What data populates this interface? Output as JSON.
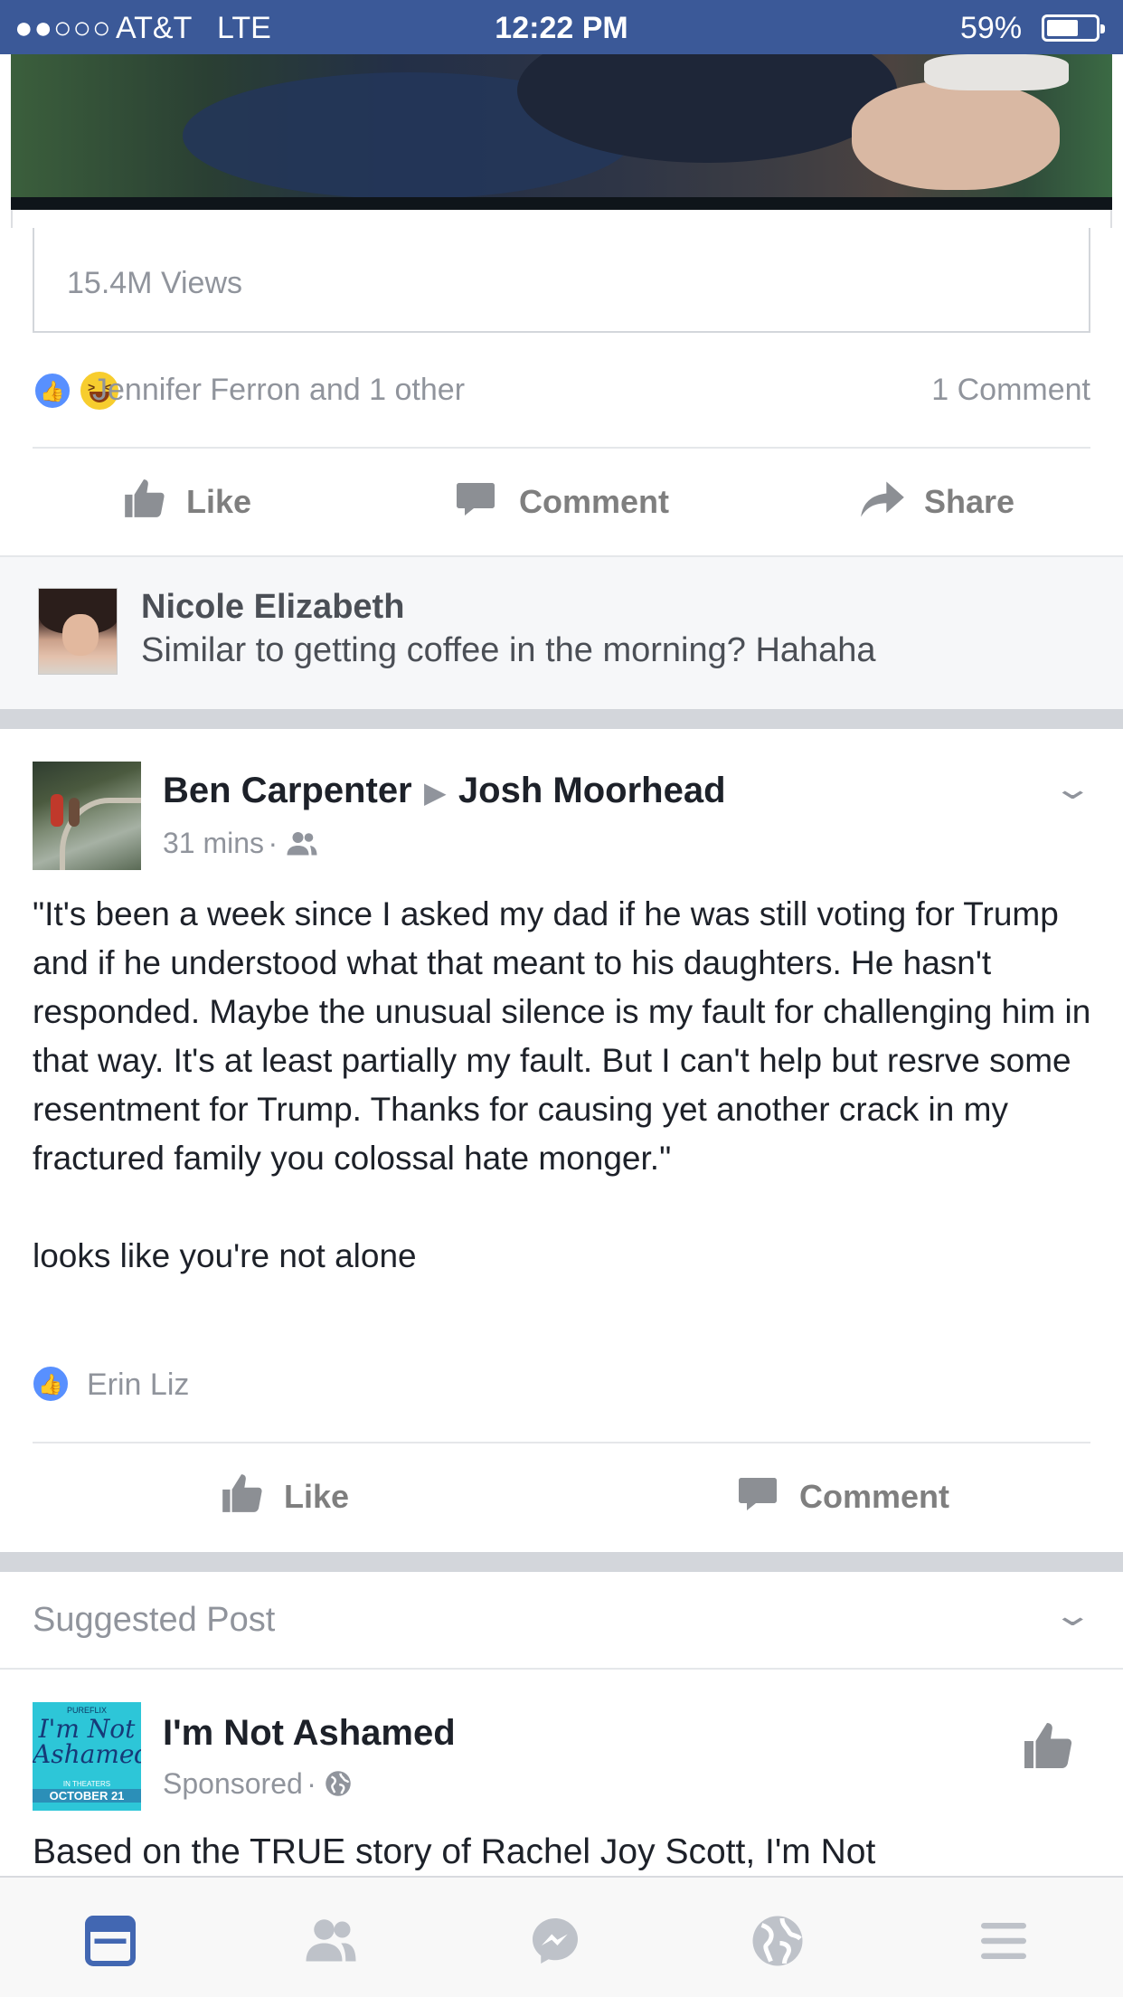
{
  "status_bar": {
    "signal": "●●○○○",
    "carrier": "AT&T",
    "network": "LTE",
    "time": "12:22 PM",
    "battery": "59%",
    "battery_level": 0.59
  },
  "video_post": {
    "views": "15.4M Views",
    "reactions_text": "Jennifer Ferron and 1 other",
    "comment_count": "1 Comment",
    "actions": {
      "like": "Like",
      "comment": "Comment",
      "share": "Share"
    }
  },
  "comment": {
    "author": "Nicole Elizabeth",
    "text": "Similar to getting coffee in the morning? Hahaha"
  },
  "post": {
    "author": "Ben Carpenter",
    "recipient": "Josh Moorhead",
    "time": "31 mins",
    "quote": "\"It's been a week since I asked my dad if he was still voting for Trump and if he understood what that meant to his daughters. He hasn't responded. Maybe the unusual silence is my fault for challenging him in that way. It's at least partially my fault. But I can't help but resrve some resentment for Trump. Thanks for causing yet another crack in my fractured family you colossal hate monger.\"",
    "comment": "looks like you're not alone",
    "liked_by": "Erin Liz",
    "actions": {
      "like": "Like",
      "comment": "Comment"
    }
  },
  "suggested": {
    "title": "Suggested Post",
    "page_name": "I'm Not Ashamed",
    "sponsored": "Sponsored",
    "logo": {
      "top": "PUREFLIX",
      "title": "I'm Not Ashamed",
      "sub": "IN THEATERS",
      "date": "OCTOBER 21"
    },
    "text": "Based on the TRUE story of Rachel Joy Scott, I'm Not"
  },
  "bottom_nav": {
    "items": [
      "news-feed-icon",
      "friends-icon",
      "messenger-icon",
      "globe-icon",
      "menu-icon"
    ],
    "active_color": "#4267b2",
    "inactive_color": "#bec2c9"
  },
  "colors": {
    "brand": "#3b5998",
    "like_blue": "#5890ff",
    "meta_gray": "#90949c"
  }
}
